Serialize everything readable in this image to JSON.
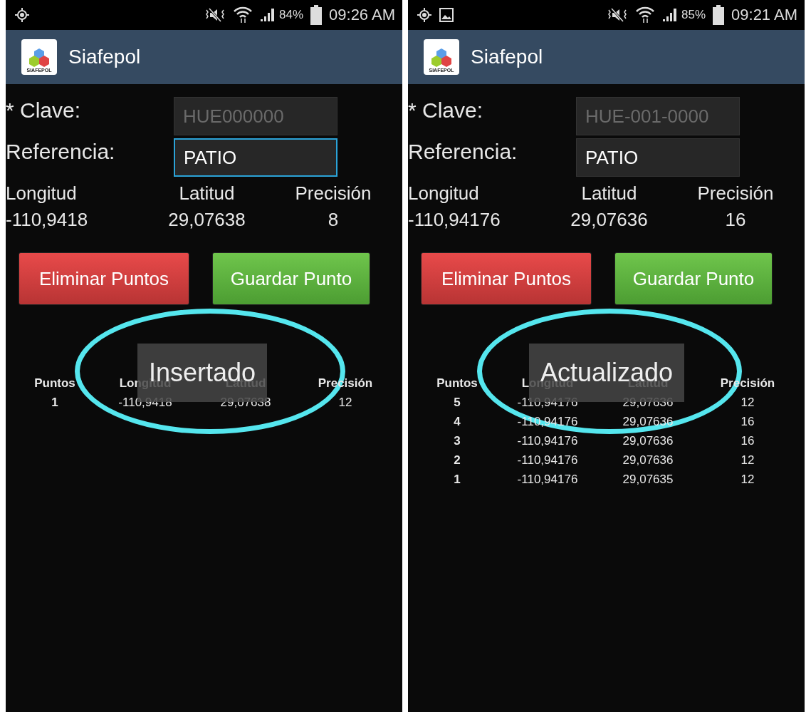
{
  "screens": [
    {
      "status_bar": {
        "notifications": [
          {
            "kind": "location"
          }
        ],
        "battery": "84%",
        "time": "09:26 AM"
      },
      "app_bar": {
        "title": "Siafepol",
        "logo_text": "SIAFEPOL"
      },
      "form": {
        "clave_label": "* Clave:",
        "clave_value": "HUE000000",
        "clave_disabled": true,
        "referencia_label": "Referencia:",
        "referencia_value": "PATIO",
        "referencia_focused": true
      },
      "coordinates": {
        "headers": [
          "Longitud",
          "Latitud",
          "Precisión"
        ],
        "values": [
          "-110,9418",
          "29,07638",
          "8"
        ]
      },
      "buttons": [
        {
          "label": "Eliminar Puntos",
          "kind": "danger"
        },
        {
          "label": "Guardar Punto",
          "kind": "success"
        }
      ],
      "toast": "Insertado",
      "table": {
        "columns": [
          "Puntos",
          "Longitud",
          "Latitud",
          "Precisión"
        ],
        "rows": [
          [
            "1",
            "-110,9418",
            "29,07638",
            "12"
          ]
        ]
      }
    },
    {
      "status_bar": {
        "notifications": [
          {
            "kind": "location"
          },
          {
            "kind": "image"
          }
        ],
        "battery": "85%",
        "time": "09:21 AM"
      },
      "app_bar": {
        "title": "Siafepol",
        "logo_text": "SIAFEPOL"
      },
      "form": {
        "clave_label": "* Clave:",
        "clave_value": "HUE-001-0000",
        "clave_disabled": true,
        "referencia_label": "Referencia:",
        "referencia_value": "PATIO",
        "referencia_focused": false
      },
      "coordinates": {
        "headers": [
          "Longitud",
          "Latitud",
          "Precisión"
        ],
        "values": [
          "-110,94176",
          "29,07636",
          "16"
        ]
      },
      "buttons": [
        {
          "label": "Eliminar Puntos",
          "kind": "danger"
        },
        {
          "label": "Guardar Punto",
          "kind": "success"
        }
      ],
      "toast": "Actualizado",
      "table": {
        "columns": [
          "Puntos",
          "Longitud",
          "Latitud",
          "Precisión"
        ],
        "rows": [
          [
            "5",
            "-110,94176",
            "29,07636",
            "12"
          ],
          [
            "4",
            "-110,94176",
            "29,07636",
            "16"
          ],
          [
            "3",
            "-110,94176",
            "29,07636",
            "16"
          ],
          [
            "2",
            "-110,94176",
            "29,07636",
            "12"
          ],
          [
            "1",
            "-110,94176",
            "29,07635",
            "12"
          ]
        ]
      }
    }
  ]
}
